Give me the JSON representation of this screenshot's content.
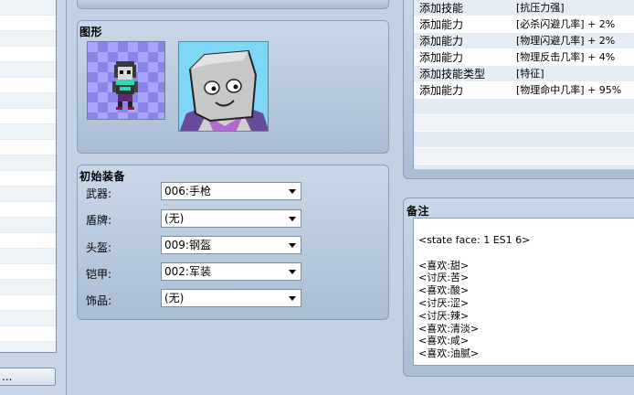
{
  "left_panel": {
    "more_button_label": "..."
  },
  "graphics": {
    "title": "图形"
  },
  "equipment": {
    "title": "初始装备",
    "slots": [
      {
        "label": "武器:",
        "value": "006:手枪"
      },
      {
        "label": "盾牌:",
        "value": "(无)"
      },
      {
        "label": "头盔:",
        "value": "009:钢盔"
      },
      {
        "label": "铠甲:",
        "value": "002:军装"
      },
      {
        "label": "饰品:",
        "value": "(无)"
      }
    ]
  },
  "traits": {
    "rows": [
      {
        "type": "添加技能",
        "content": "[抗压力强]"
      },
      {
        "type": "添加能力",
        "content": "[必杀闪避几率] + 2%"
      },
      {
        "type": "添加能力",
        "content": "[物理闪避几率] + 2%"
      },
      {
        "type": "添加能力",
        "content": "[物理反击几率] + 4%"
      },
      {
        "type": "添加技能类型",
        "content": "[特征]"
      },
      {
        "type": "添加能力",
        "content": "[物理命中几率] + 95%"
      }
    ]
  },
  "notes": {
    "title": "备注",
    "content": "<state face: 1 ES1 6>\n\n<喜欢:甜>\n<讨厌:苦>\n<喜欢:酸>\n<讨厌:涩>\n<讨厌:辣>\n<喜欢:清淡>\n<喜欢:咸>\n<喜欢:油腻>"
  }
}
